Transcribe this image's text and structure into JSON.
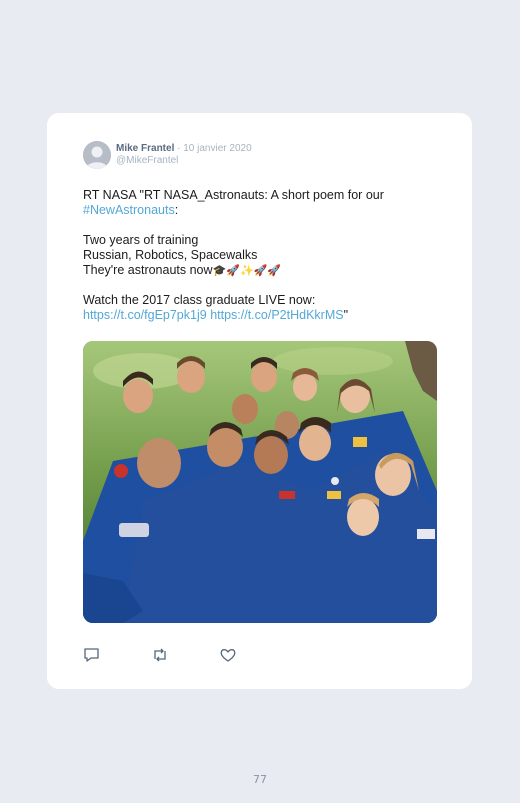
{
  "tweet": {
    "author_name": "Mike Frantel",
    "date": "· 10 janvier 2020",
    "handle": "@MikeFrantel",
    "line1": "RT NASA \"RT NASA_Astronauts: A short poem for our",
    "hashtag": "#NewAstronauts",
    "hashtag_after": ":",
    "poem_line1": "Two years of training",
    "poem_line2": "Russian, Robotics, Spacewalks",
    "poem_line3": "They're astronauts now",
    "poem_emojis": "🎓🚀✨🚀🚀",
    "watch_line": "Watch the 2017 class graduate LIVE now:",
    "link1": "https://t.co/fgEp7pk1j9",
    "link2": "https://t.co/P2tHdKkrMS",
    "closing_quote": "\""
  },
  "photo": {
    "subject": "group selfie of astronauts in blue flight suits on grass"
  },
  "actions": {
    "reply_icon": "reply-icon",
    "retweet_icon": "retweet-icon",
    "like_icon": "heart-icon"
  },
  "page": {
    "number": "77"
  },
  "colors": {
    "background": "#e8ebf2",
    "card": "#ffffff",
    "link": "#53a8d6",
    "suit": "#1f4fa0"
  }
}
